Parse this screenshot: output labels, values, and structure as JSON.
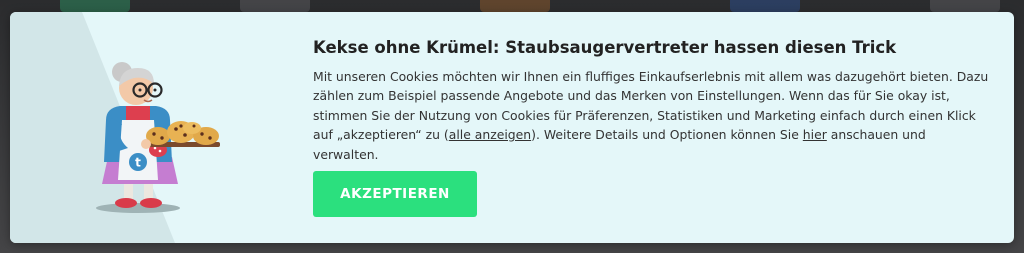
{
  "cookie_banner": {
    "title": "Kekse ohne Krümel: Staubsaugervertreter hassen diesen Trick",
    "text_1": "Mit unseren Cookies möchten wir Ihnen ein fluffiges Einkaufserlebnis mit allem was dazugehört bieten. Dazu zählen zum Beispiel passende Angebote und das Merken von Einstellungen. Wenn das für Sie okay ist, stimmen Sie der Nutzung von Cookies für Präferenzen, Statistiken und Marketing einfach durch einen Klick auf „akzeptieren“ zu (",
    "show_all_link": "alle anzeigen",
    "text_2": "). Weitere Details und Optionen können Sie ",
    "here_link": "hier",
    "text_3": " anschauen und verwalten.",
    "accept_label": "AKZEPTIEREN"
  },
  "illustration": {
    "description_icon": "grandma-baking-cookies-icon",
    "apron_letter": "t"
  },
  "colors": {
    "banner_bg": "#e4f7f9",
    "accept_button": "#2be07e",
    "title_text": "#222222",
    "body_text": "#333333"
  }
}
